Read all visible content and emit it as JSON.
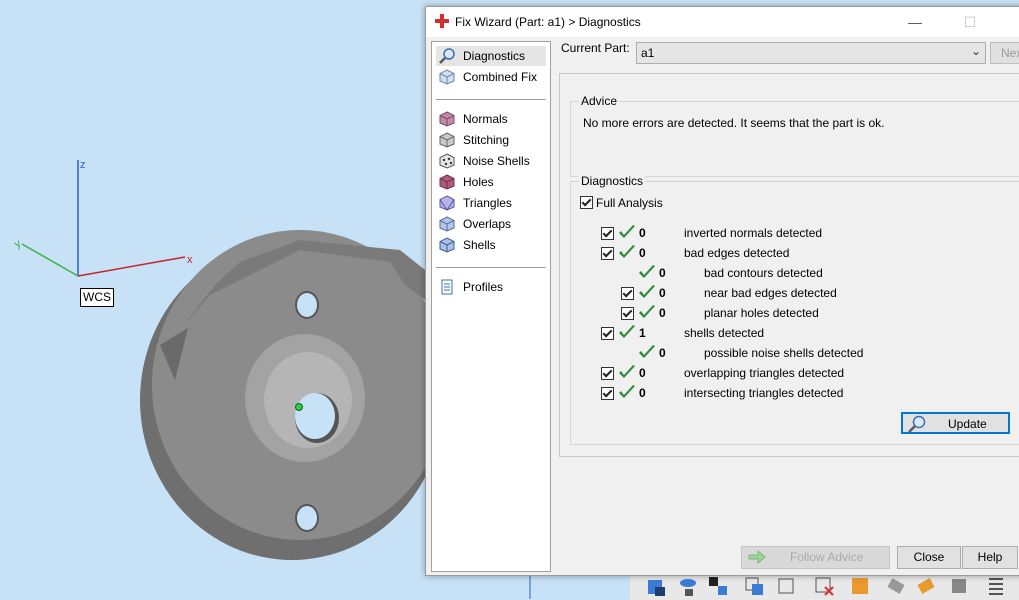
{
  "viewport": {
    "wcs_label": "WCS",
    "axis_z": "z",
    "axis_x": "x",
    "axis_y": "y"
  },
  "dialog": {
    "title": "Fix Wizard (Part: a1) > Diagnostics",
    "window_controls": {
      "minimize": "—",
      "maximize": "☐",
      "close": "✕"
    },
    "current_part_label": "Current Part:",
    "current_part_value": "a1",
    "next_label": "Nex",
    "nav": {
      "top": [
        {
          "label": "Diagnostics",
          "icon": "magnifier-icon",
          "selected": true
        },
        {
          "label": "Combined Fix",
          "icon": "cube-icon",
          "selected": false
        }
      ],
      "tools": [
        {
          "label": "Normals",
          "icon": "normals-cube-icon"
        },
        {
          "label": "Stitching",
          "icon": "stitching-cube-icon"
        },
        {
          "label": "Noise Shells",
          "icon": "noise-shells-icon"
        },
        {
          "label": "Holes",
          "icon": "holes-cube-icon"
        },
        {
          "label": "Triangles",
          "icon": "triangles-cube-icon"
        },
        {
          "label": "Overlaps",
          "icon": "overlaps-cube-icon"
        },
        {
          "label": "Shells",
          "icon": "shells-cube-icon"
        }
      ],
      "bottom": [
        {
          "label": "Profiles",
          "icon": "document-icon"
        }
      ]
    },
    "advice": {
      "title": "Advice",
      "text": "No more errors are detected. It seems that the part is ok."
    },
    "diagnostics": {
      "title": "Diagnostics",
      "full_analysis_label": "Full Analysis",
      "rows": [
        {
          "checkbox": true,
          "count": "0",
          "text": "inverted normals detected",
          "indent": 0
        },
        {
          "checkbox": true,
          "count": "0",
          "text": "bad edges detected",
          "indent": 0
        },
        {
          "checkbox": false,
          "count": "0",
          "text": "bad contours detected",
          "indent": 1
        },
        {
          "checkbox": true,
          "count": "0",
          "text": "near bad edges detected",
          "indent": 1
        },
        {
          "checkbox": true,
          "count": "0",
          "text": "planar holes detected",
          "indent": 1
        },
        {
          "checkbox": true,
          "count": "1",
          "text": "shells detected",
          "indent": 0
        },
        {
          "checkbox": false,
          "count": "0",
          "text": "possible noise shells detected",
          "indent": 1
        },
        {
          "checkbox": true,
          "count": "0",
          "text": "overlapping triangles detected",
          "indent": 0
        },
        {
          "checkbox": true,
          "count": "0",
          "text": "intersecting triangles detected",
          "indent": 0
        }
      ],
      "update_label": "Update"
    },
    "buttons": {
      "follow_advice": "Follow Advice",
      "close": "Close",
      "help": "Help"
    }
  },
  "colors": {
    "viewport_bg": "#c7e1f7",
    "tick_green": "#2e8b3a",
    "accent_blue": "#0078d7",
    "part_gray": "#8a8a8a"
  }
}
